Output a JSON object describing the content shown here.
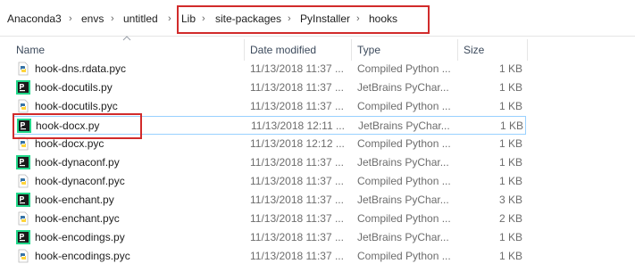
{
  "breadcrumb": {
    "items": [
      "Anaconda3",
      "envs",
      "untitled",
      "Lib",
      "site-packages",
      "PyInstaller",
      "hooks"
    ]
  },
  "columns": {
    "name": "Name",
    "date": "Date modified",
    "type": "Type",
    "size": "Size"
  },
  "files": [
    {
      "name": "hook-dns.rdata.pyc",
      "date": "11/13/2018 11:37 ...",
      "type": "Compiled Python ...",
      "size": "1 KB",
      "icon": "python-compiled-icon"
    },
    {
      "name": "hook-docutils.py",
      "date": "11/13/2018 11:37 ...",
      "type": "JetBrains PyChar...",
      "size": "1 KB",
      "icon": "pycharm-file-icon"
    },
    {
      "name": "hook-docutils.pyc",
      "date": "11/13/2018 11:37 ...",
      "type": "Compiled Python ...",
      "size": "1 KB",
      "icon": "python-compiled-icon"
    },
    {
      "name": "hook-docx.py",
      "date": "11/13/2018 12:11 ...",
      "type": "JetBrains PyChar...",
      "size": "1 KB",
      "icon": "pycharm-file-icon"
    },
    {
      "name": "hook-docx.pyc",
      "date": "11/13/2018 12:12 ...",
      "type": "Compiled Python ...",
      "size": "1 KB",
      "icon": "python-compiled-icon"
    },
    {
      "name": "hook-dynaconf.py",
      "date": "11/13/2018 11:37 ...",
      "type": "JetBrains PyChar...",
      "size": "1 KB",
      "icon": "pycharm-file-icon"
    },
    {
      "name": "hook-dynaconf.pyc",
      "date": "11/13/2018 11:37 ...",
      "type": "Compiled Python ...",
      "size": "1 KB",
      "icon": "python-compiled-icon"
    },
    {
      "name": "hook-enchant.py",
      "date": "11/13/2018 11:37 ...",
      "type": "JetBrains PyChar...",
      "size": "3 KB",
      "icon": "pycharm-file-icon"
    },
    {
      "name": "hook-enchant.pyc",
      "date": "11/13/2018 11:37 ...",
      "type": "Compiled Python ...",
      "size": "2 KB",
      "icon": "python-compiled-icon"
    },
    {
      "name": "hook-encodings.py",
      "date": "11/13/2018 11:37 ...",
      "type": "JetBrains PyChar...",
      "size": "1 KB",
      "icon": "pycharm-file-icon"
    },
    {
      "name": "hook-encodings.pyc",
      "date": "11/13/2018 11:37 ...",
      "type": "Compiled Python ...",
      "size": "1 KB",
      "icon": "python-compiled-icon"
    }
  ],
  "colors": {
    "highlight_border": "#d12b2b",
    "selection_border": "#99d1ff",
    "pycharm_dark": "#1a1a1a",
    "pycharm_green": "#21d789",
    "python_blue": "#3572a5",
    "python_yellow": "#ffd43b"
  }
}
